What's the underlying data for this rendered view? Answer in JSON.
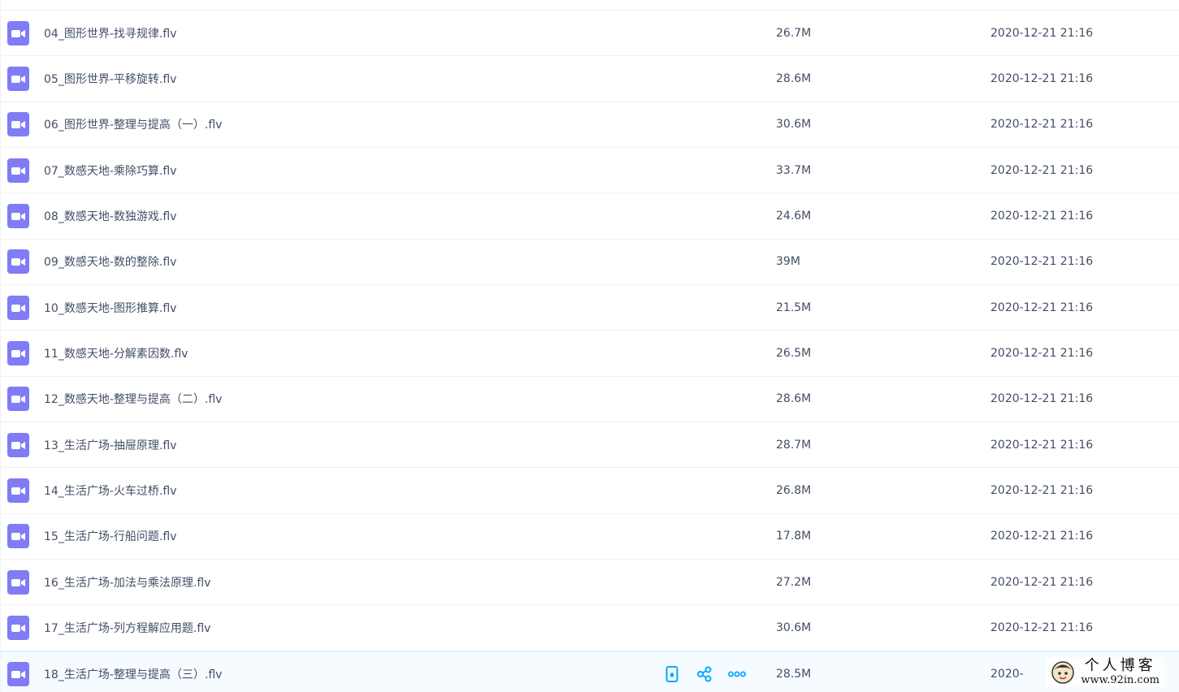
{
  "files": [
    {
      "name": "04_图形世界-找寻规律.flv",
      "size": "26.7M",
      "date": "2020-12-21 21:16"
    },
    {
      "name": "05_图形世界-平移旋转.flv",
      "size": "28.6M",
      "date": "2020-12-21 21:16"
    },
    {
      "name": "06_图形世界-整理与提高（一）.flv",
      "size": "30.6M",
      "date": "2020-12-21 21:16"
    },
    {
      "name": "07_数感天地-乘除巧算.flv",
      "size": "33.7M",
      "date": "2020-12-21 21:16"
    },
    {
      "name": "08_数感天地-数独游戏.flv",
      "size": "24.6M",
      "date": "2020-12-21 21:16"
    },
    {
      "name": "09_数感天地-数的整除.flv",
      "size": "39M",
      "date": "2020-12-21 21:16"
    },
    {
      "name": "10_数感天地-图形推算.flv",
      "size": "21.5M",
      "date": "2020-12-21 21:16"
    },
    {
      "name": "11_数感天地-分解素因数.flv",
      "size": "26.5M",
      "date": "2020-12-21 21:16"
    },
    {
      "name": "12_数感天地-整理与提高（二）.flv",
      "size": "28.6M",
      "date": "2020-12-21 21:16"
    },
    {
      "name": "13_生活广场-抽屉原理.flv",
      "size": "28.7M",
      "date": "2020-12-21 21:16"
    },
    {
      "name": "14_生活广场-火车过桥.flv",
      "size": "26.8M",
      "date": "2020-12-21 21:16"
    },
    {
      "name": "15_生活广场-行船问题.flv",
      "size": "17.8M",
      "date": "2020-12-21 21:16"
    },
    {
      "name": "16_生活广场-加法与乘法原理.flv",
      "size": "27.2M",
      "date": "2020-12-21 21:16"
    },
    {
      "name": "17_生活广场-列方程解应用题.flv",
      "size": "30.6M",
      "date": "2020-12-21 21:16"
    },
    {
      "name": "18_生活广场-整理与提高（三）.flv",
      "size": "28.5M",
      "date": "2020-"
    }
  ],
  "icons": {
    "file": "video-file-icon",
    "actions": [
      "phone-icon",
      "share-icon",
      "more-icon"
    ]
  },
  "watermark": {
    "title": "个人博客",
    "url": "www.92in.com"
  },
  "colors": {
    "video_icon": "#7f7cf6",
    "action_icon": "#06a7ff",
    "text": "#424e67",
    "hover_row": "#f5fbff"
  }
}
